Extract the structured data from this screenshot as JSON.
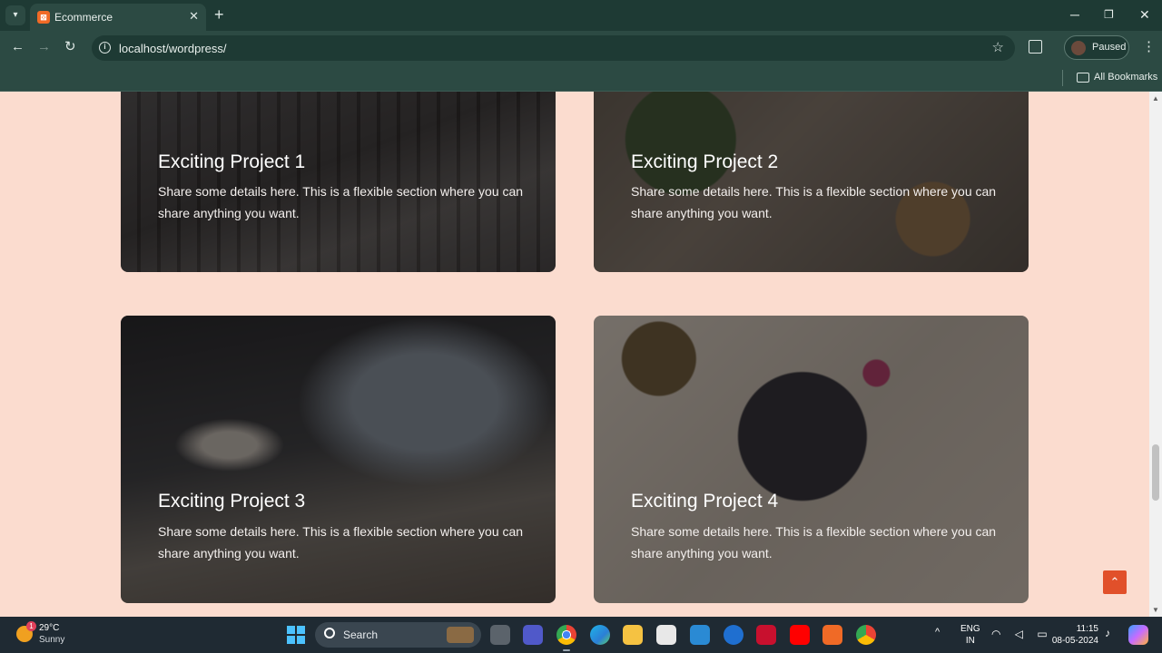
{
  "browser": {
    "tab_title": "Ecommerce",
    "favicon_glyph": "⊠",
    "tab_close": "✕",
    "new_tab": "+",
    "url": "localhost/wordpress/",
    "profile_label": "Paused",
    "bookmarks_label": "All Bookmarks",
    "icons": {
      "back": "←",
      "forward": "→",
      "reload": "↻",
      "star": "☆",
      "menu": "⋮",
      "minimize": "─",
      "maximize": "❐",
      "close": "✕",
      "tab_search": "▾"
    }
  },
  "projects": [
    {
      "title": "Exciting Project 1",
      "text": "Share some details here. This is a flexible section where you can share anything you want."
    },
    {
      "title": "Exciting Project 2",
      "text": "Share some details here. This is a flexible section where you can share anything you want."
    },
    {
      "title": "Exciting Project 3",
      "text": "Share some details here. This is a flexible section where you can share anything you want."
    },
    {
      "title": "Exciting Project 4",
      "text": "Share some details here. This is a flexible section where you can share anything you want."
    }
  ],
  "scroll_top_glyph": "⌃",
  "colors": {
    "page_bg": "#fbdccf",
    "accent": "#e1502a",
    "chrome": "#2c4a43"
  },
  "taskbar": {
    "weather_temp": "29°C",
    "weather_condition": "Sunny",
    "weather_badge": "1",
    "search_label": "Search",
    "lang_1": "ENG",
    "lang_2": "IN",
    "time": "11:15",
    "date": "08-05-2024",
    "tray_caret": "^",
    "tray_icons": "◠ ◁ ▭",
    "bell": "♪"
  }
}
